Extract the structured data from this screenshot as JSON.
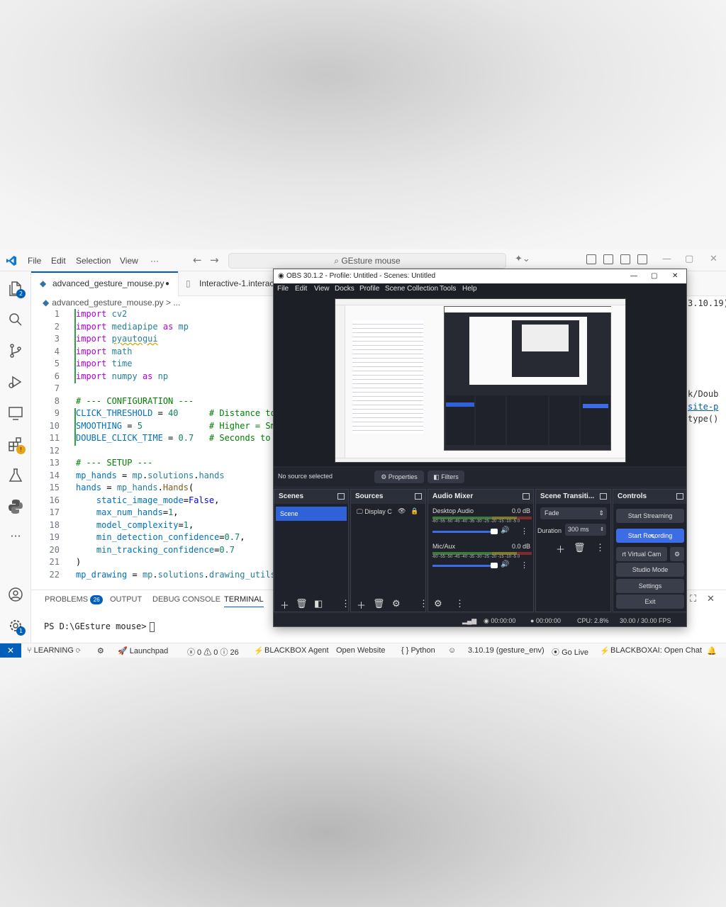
{
  "vscode": {
    "menu": [
      "File",
      "Edit",
      "Selection",
      "View",
      "···"
    ],
    "search_placeholder": "GEsture mouse",
    "tabs": [
      {
        "label": "advanced_gesture_mouse.py"
      },
      {
        "label": "Interactive-1.interac"
      }
    ],
    "breadcrumb": "advanced_gesture_mouse.py  >  ...",
    "explorer_badge": "2",
    "settings_badge": "1",
    "code_lines": [
      {
        "n": "1",
        "text": "import cv2"
      },
      {
        "n": "2",
        "text": "import mediapipe as mp"
      },
      {
        "n": "3",
        "text": "import pyautogui"
      },
      {
        "n": "4",
        "text": "import math"
      },
      {
        "n": "5",
        "text": "import time"
      },
      {
        "n": "6",
        "text": "import numpy as np"
      },
      {
        "n": "7",
        "text": ""
      },
      {
        "n": "8",
        "text": "# --- CONFIGURATION ---"
      },
      {
        "n": "9",
        "text": "CLICK_THRESHOLD = 40      # Distance to"
      },
      {
        "n": "10",
        "text": "SMOOTHING = 5             # Higher = Smo"
      },
      {
        "n": "11",
        "text": "DOUBLE_CLICK_TIME = 0.7   # Seconds to"
      },
      {
        "n": "12",
        "text": ""
      },
      {
        "n": "13",
        "text": "# --- SETUP ---"
      },
      {
        "n": "14",
        "text": "mp_hands = mp.solutions.hands"
      },
      {
        "n": "15",
        "text": "hands = mp_hands.Hands("
      },
      {
        "n": "16",
        "text": "    static_image_mode=False,"
      },
      {
        "n": "17",
        "text": "    max_num_hands=1,"
      },
      {
        "n": "18",
        "text": "    model_complexity=1,"
      },
      {
        "n": "19",
        "text": "    min_detection_confidence=0.7,"
      },
      {
        "n": "20",
        "text": "    min_tracking_confidence=0.7"
      },
      {
        "n": "21",
        "text": ")"
      },
      {
        "n": "22",
        "text": "mp_drawing = mp.solutions.drawing_utils"
      }
    ],
    "right_snippets": [
      "3.10.19)",
      "k/Doub",
      "site-p",
      "type()"
    ],
    "panel_tabs": [
      "PROBLEMS",
      "OUTPUT",
      "DEBUG CONSOLE",
      "TERMINAL"
    ],
    "problems_count": "26",
    "terminal_prompt": "PS D:\\GEsture mouse>",
    "statusbar": {
      "branch": "LEARNING",
      "launchpad": "Launchpad",
      "problems": "ⓧ 0 ⚠ 0 ⓘ 26",
      "blackbox": "BLACKBOX Agent",
      "open_website": "Open Website",
      "python": "{ } Python",
      "env": "3.10.19 (gesture_env)",
      "golive": "Go Live",
      "blackboxai": "BLACKBOXAI: Open Chat"
    }
  },
  "obs": {
    "title": "OBS 30.1.2 - Profile: Untitled - Scenes: Untitled",
    "menu": [
      "File",
      "Edit",
      "View",
      "Docks",
      "Profile",
      "Scene Collection",
      "Tools",
      "Help"
    ],
    "no_source": "No source selected",
    "properties": "Properties",
    "filters": "Filters",
    "docks": {
      "scenes": "Scenes",
      "sources": "Sources",
      "audio_mixer": "Audio Mixer",
      "transitions": "Scene Transiti...",
      "controls": "Controls"
    },
    "scene_item": "Scene",
    "source_item": "Display C",
    "audio": [
      {
        "name": "Desktop Audio",
        "db": "0.0 dB"
      },
      {
        "name": "Mic/Aux",
        "db": "0.0 dB"
      }
    ],
    "meter_scale": "-60 -55 -50 -45 -40 -35 -30 -25 -20 -15 -10 -5 0",
    "transition": "Fade",
    "duration_label": "Duration",
    "duration_value": "300 ms",
    "controls": [
      "Start Streaming",
      "Start Recording",
      "rt Virtual Cam",
      "Studio Mode",
      "Settings",
      "Exit"
    ],
    "status": {
      "stream_time": "00:00:00",
      "rec_time": "00:00:00",
      "cpu": "CPU: 2.8%",
      "fps": "30.00 / 30.00 FPS"
    }
  },
  "colors": {
    "vscode_accent": "#005fb8",
    "obs_bg": "#272a33",
    "obs_accent": "#3c6ce6"
  }
}
